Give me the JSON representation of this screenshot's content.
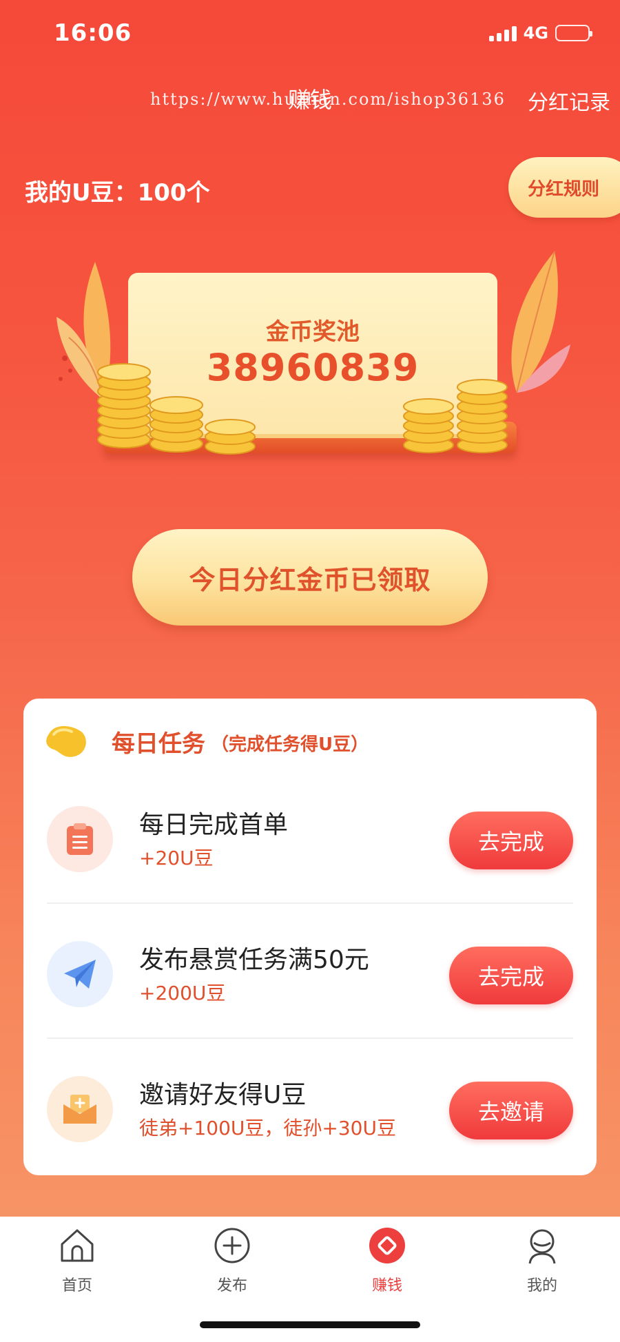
{
  "status": {
    "time": "16:06",
    "network": "4G"
  },
  "header": {
    "title": "赚钱",
    "watermark": "https://www.huzhan.com/ishop36136",
    "right_link": "分红记录"
  },
  "balance": {
    "label": "我的U豆：100个",
    "rule_button": "分红规则"
  },
  "pool": {
    "label": "金币奖池",
    "value": "38960839"
  },
  "claim_button": "今日分红金币已领取",
  "tasks": {
    "title": "每日任务",
    "subtitle": "（完成任务得U豆）",
    "items": [
      {
        "name": "每日完成首单",
        "reward": "+20U豆",
        "button": "去完成",
        "icon": "clipboard-icon"
      },
      {
        "name": "发布悬赏任务满50元",
        "reward": "+200U豆",
        "button": "去完成",
        "icon": "paper-plane-icon"
      },
      {
        "name": "邀请好友得U豆",
        "reward": "徒弟+100U豆，徒孙+30U豆",
        "button": "去邀请",
        "icon": "envelope-icon"
      }
    ]
  },
  "tabbar": {
    "items": [
      {
        "label": "首页",
        "icon": "home-icon"
      },
      {
        "label": "发布",
        "icon": "plus-circle-icon"
      },
      {
        "label": "赚钱",
        "icon": "earn-icon",
        "active": true
      },
      {
        "label": "我的",
        "icon": "person-icon"
      }
    ]
  },
  "colors": {
    "accent": "#e0502c",
    "button_red": "#f03a3c",
    "gold": "#fde39f"
  }
}
